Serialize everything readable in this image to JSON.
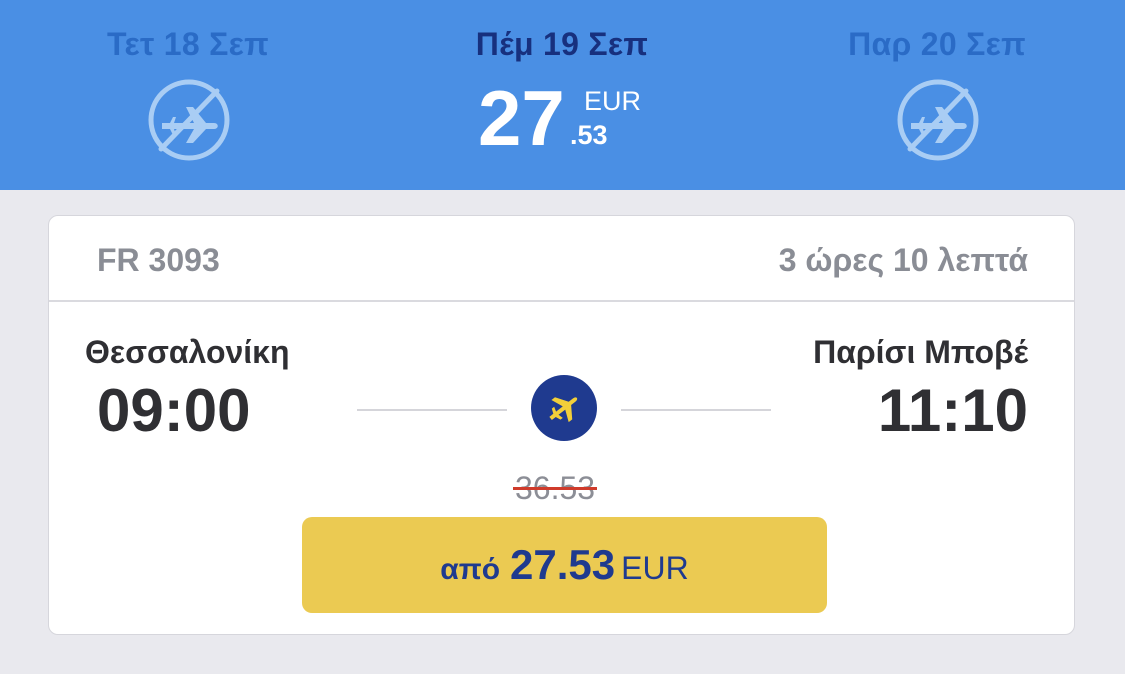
{
  "dates": [
    {
      "label": "Τετ 18 Σεπ",
      "available": false,
      "icon": "no-flight-icon"
    },
    {
      "label": "Πέμ 19 Σεπ",
      "available": true,
      "selected": true,
      "price_int": "27",
      "price_dec": ".53",
      "currency": "EUR"
    },
    {
      "label": "Παρ 20 Σεπ",
      "available": false,
      "icon": "no-flight-icon"
    }
  ],
  "flight": {
    "number": "FR 3093",
    "duration": "3 ώρες 10 λεπτά",
    "origin_city": "Θεσσαλονίκη",
    "origin_time": "09:00",
    "destination_city": "Παρίσι Μποβέ",
    "destination_time": "11:10",
    "plane_icon": "airplane-icon",
    "old_price": "36.53",
    "cta": {
      "from_label": "από",
      "amount": "27.53",
      "currency": "EUR"
    }
  },
  "colors": {
    "header_bg": "#4a8fe4",
    "selected_date": "#17307e",
    "unavailable_date": "#2a6bc6",
    "brand_blue": "#1f3a8f",
    "cta_yellow": "#ebca52",
    "strike_red": "#cf3b2b",
    "page_bg": "#e9e9ee"
  }
}
